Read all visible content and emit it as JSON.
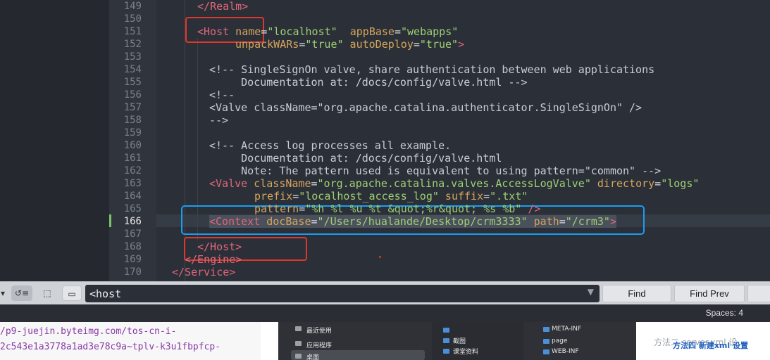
{
  "editor": {
    "lines": [
      {
        "num": "149",
        "segments": [
          {
            "t": "&lt;/",
            "c": "tag",
            "raw": "</"
          },
          {
            "t": "Realm",
            "c": "tag"
          },
          {
            "t": ">",
            "c": "tag"
          }
        ]
      },
      {
        "num": "150",
        "segments": []
      },
      {
        "num": "151",
        "segments": [
          {
            "t": "<Host",
            "c": "tag"
          },
          {
            "t": " name",
            "c": "attr"
          },
          {
            "t": "=",
            "c": "plain"
          },
          {
            "t": "\"localhost\"",
            "c": "str"
          },
          {
            "t": "  appBase",
            "c": "attr"
          },
          {
            "t": "=",
            "c": "plain"
          },
          {
            "t": "\"webapps\"",
            "c": "str"
          }
        ]
      },
      {
        "num": "152",
        "segments": [
          {
            "t": "unpackWARs",
            "c": "attr"
          },
          {
            "t": "=",
            "c": "plain"
          },
          {
            "t": "\"true\"",
            "c": "str"
          },
          {
            "t": " autoDeploy",
            "c": "attr"
          },
          {
            "t": "=",
            "c": "plain"
          },
          {
            "t": "\"true\"",
            "c": "str"
          },
          {
            "t": ">",
            "c": "tag"
          }
        ]
      },
      {
        "num": "153",
        "segments": []
      },
      {
        "num": "154",
        "segments": [
          {
            "t": "<!-- SingleSignOn valve, share authentication between web applications",
            "c": "cmt"
          }
        ]
      },
      {
        "num": "155",
        "segments": [
          {
            "t": "     Documentation at: /docs/config/valve.html -->",
            "c": "cmt"
          }
        ]
      },
      {
        "num": "156",
        "segments": [
          {
            "t": "<!--",
            "c": "cmt"
          }
        ]
      },
      {
        "num": "157",
        "segments": [
          {
            "t": "<Valve className=\"org.apache.catalina.authenticator.SingleSignOn\" />",
            "c": "cmt"
          }
        ]
      },
      {
        "num": "158",
        "segments": [
          {
            "t": "-->",
            "c": "cmt"
          }
        ]
      },
      {
        "num": "159",
        "segments": []
      },
      {
        "num": "160",
        "segments": [
          {
            "t": "<!-- Access log processes all example.",
            "c": "cmt"
          }
        ]
      },
      {
        "num": "161",
        "segments": [
          {
            "t": "     Documentation at: /docs/config/valve.html",
            "c": "cmt"
          }
        ]
      },
      {
        "num": "162",
        "segments": [
          {
            "t": "     Note: The pattern used is equivalent to using pattern=\"common\" -->",
            "c": "cmt"
          }
        ]
      },
      {
        "num": "163",
        "segments": [
          {
            "t": "<Valve",
            "c": "tag"
          },
          {
            "t": " className",
            "c": "attr"
          },
          {
            "t": "=",
            "c": "plain"
          },
          {
            "t": "\"org.apache.catalina.valves.AccessLogValve\"",
            "c": "str"
          },
          {
            "t": " directory",
            "c": "attr"
          },
          {
            "t": "=",
            "c": "plain"
          },
          {
            "t": "\"logs\"",
            "c": "str"
          }
        ]
      },
      {
        "num": "164",
        "segments": [
          {
            "t": "prefix",
            "c": "attr"
          },
          {
            "t": "=",
            "c": "plain"
          },
          {
            "t": "\"localhost_access_log\"",
            "c": "str"
          },
          {
            "t": " suffix",
            "c": "attr"
          },
          {
            "t": "=",
            "c": "plain"
          },
          {
            "t": "\".txt\"",
            "c": "str"
          }
        ]
      },
      {
        "num": "165",
        "segments": [
          {
            "t": "pattern",
            "c": "attr"
          },
          {
            "t": "=",
            "c": "plain"
          },
          {
            "t": "\"%h %l %u %t &quot;%r&quot; %s %b\"",
            "c": "str"
          },
          {
            "t": " />",
            "c": "tag"
          }
        ]
      },
      {
        "num": "166",
        "segments": [
          {
            "t": "<Context",
            "c": "tag"
          },
          {
            "t": " docBase",
            "c": "attr"
          },
          {
            "t": "=",
            "c": "plain"
          },
          {
            "t": "\"/Users/hualande/Desktop/crm3333\"",
            "c": "str"
          },
          {
            "t": " path",
            "c": "attr"
          },
          {
            "t": "=",
            "c": "plain"
          },
          {
            "t": "\"/crm3\"",
            "c": "str"
          },
          {
            "t": ">",
            "c": "tag"
          }
        ]
      },
      {
        "num": "167",
        "segments": []
      },
      {
        "num": "168",
        "segments": [
          {
            "t": "</Host>",
            "c": "tag"
          }
        ]
      },
      {
        "num": "169",
        "segments": [
          {
            "t": "</Engine>",
            "c": "tag"
          }
        ]
      },
      {
        "num": "170",
        "segments": [
          {
            "t": "</Service>",
            "c": "tag"
          }
        ]
      }
    ],
    "active_line": "166"
  },
  "findbar": {
    "search_value": "<host",
    "find_label": "Find",
    "find_prev_label": "Find Prev"
  },
  "statusbar": {
    "spaces": "Spaces: 4"
  },
  "bottom": {
    "url_line1": "/p9-juejin.byteimg.com/tos-cn-i-",
    "url_line2": "2c543e1a3778a1ad3e78c9a~tplv-k3u1fbpfcp-",
    "finder_sidebar": [
      "最近使用",
      "应用程序",
      "桌面"
    ],
    "finder_col2": [
      "截图",
      "课堂资料"
    ],
    "finder_col3": [
      "META-INF",
      "page",
      "WEB-INF"
    ],
    "right_text": "方法二 server.xml 设",
    "right_blue": "方法四 新建xml 设置"
  },
  "colors": {
    "tag": "#e0667a",
    "attr": "#d7a45b",
    "string": "#9fcf73",
    "annotation_red": "#e0362c",
    "annotation_blue": "#1a9df0"
  }
}
